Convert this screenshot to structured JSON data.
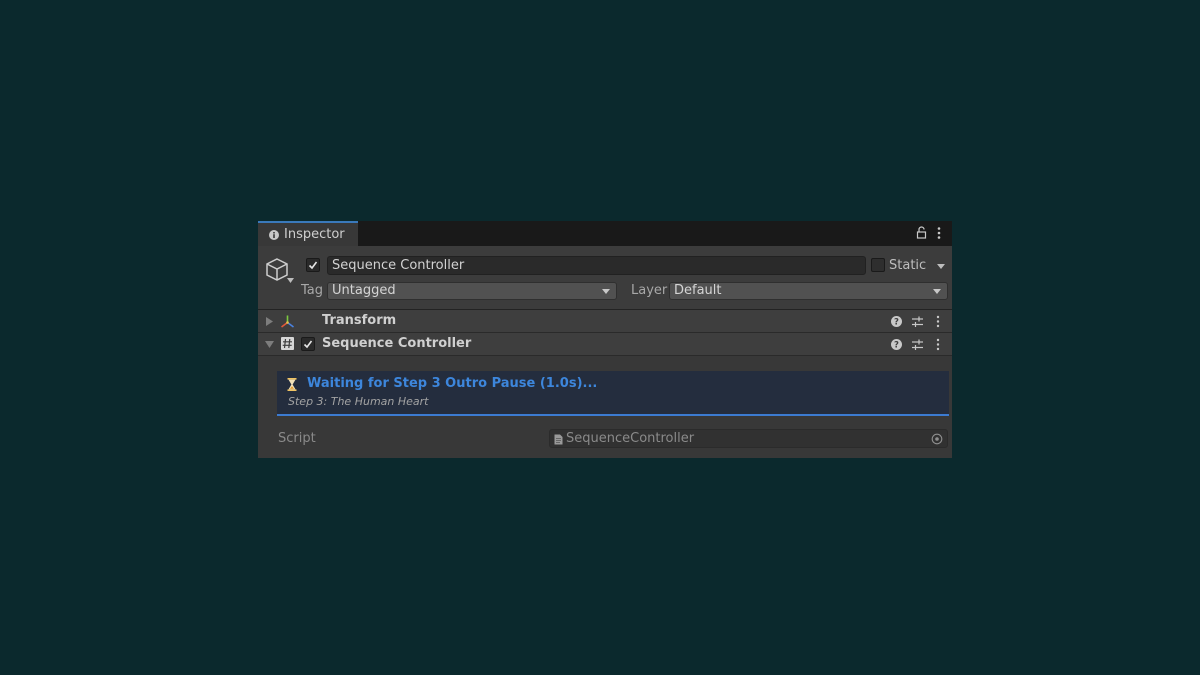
{
  "tab": {
    "title": "Inspector",
    "info_icon": "info-icon"
  },
  "tabbar_icons": {
    "lock": "lock-icon",
    "menu": "kebab-menu-icon"
  },
  "gameobject": {
    "icon": "cube-icon",
    "active": true,
    "name": "Sequence Controller",
    "static_label": "Static",
    "static_checked": false,
    "tag_label": "Tag",
    "tag_value": "Untagged",
    "layer_label": "Layer",
    "layer_value": "Default"
  },
  "components": [
    {
      "title": "Transform",
      "icon": "transform-axes-icon",
      "expanded": false,
      "has_checkbox": false
    },
    {
      "title": "Sequence Controller",
      "icon": "script-hash-icon",
      "expanded": true,
      "has_checkbox": true,
      "enabled": true
    }
  ],
  "status": {
    "icon": "hourglass-icon",
    "title": "Waiting for Step 3 Outro Pause (1.0s)...",
    "subtitle": "Step 3: The Human Heart"
  },
  "script": {
    "label": "Script",
    "value": "SequenceController"
  },
  "colors": {
    "background": "#0b292d",
    "panel": "#383838",
    "accent_blue": "#3d86dc",
    "status_box": "#242d3e",
    "hourglass": "#f0b441"
  }
}
